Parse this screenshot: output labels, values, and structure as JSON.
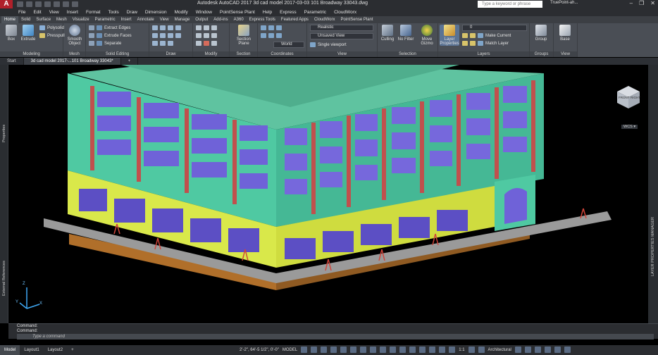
{
  "titlebar": {
    "app_logo": "A",
    "title": "Autodesk AutoCAD 2017   3d cad model 2017-03-03 101 Broadway 33043.dwg",
    "search_placeholder": "Type a keyword or phrase",
    "user": "TruePoint-ah...",
    "minimize": "–",
    "restore": "❐",
    "close": "✕"
  },
  "menubar": {
    "items": [
      "File",
      "Edit",
      "View",
      "Insert",
      "Format",
      "Tools",
      "Draw",
      "Dimension",
      "Modify",
      "Window",
      "PointSense Plant",
      "Help",
      "Express",
      "Parametric",
      "CloudWorx"
    ]
  },
  "ribbon_tabs": {
    "items": [
      "Home",
      "Solid",
      "Surface",
      "Mesh",
      "Visualize",
      "Parametric",
      "Insert",
      "Annotate",
      "View",
      "Manage",
      "Output",
      "Add-ins",
      "A360",
      "Express Tools",
      "Featured Apps",
      "CloudWorx",
      "PointSense Plant"
    ],
    "active": "Home"
  },
  "ribbon": {
    "modeling": {
      "label": "Modeling",
      "box": "Box",
      "extrude": "Extrude",
      "polysolid": "Polysolid",
      "presspull": "Presspull"
    },
    "mesh": {
      "label": "Mesh",
      "smooth_object": "Smooth Object"
    },
    "solid_editing": {
      "label": "Solid Editing",
      "extract_edges": "Extract Edges",
      "extrude_faces": "Extrude Faces",
      "separate": "Separate"
    },
    "draw": {
      "label": "Draw"
    },
    "modify": {
      "label": "Modify"
    },
    "section": {
      "label": "Section",
      "section_plane": "Section Plane"
    },
    "coordinates": {
      "label": "Coordinates",
      "world": "World"
    },
    "view": {
      "label": "View",
      "visual_style": "Realistic",
      "saved_view": "Unsaved View",
      "viewport": "Single viewport"
    },
    "selection": {
      "label": "Selection",
      "culling": "Culling",
      "no_filter": "No Filter",
      "move_gizmo": "Move Gizmo"
    },
    "layers": {
      "label": "Layers",
      "layer_properties": "Layer Properties",
      "current_layer": "0",
      "make_current": "Make Current",
      "match_layer": "Match Layer"
    },
    "groups": {
      "label": "Groups",
      "group": "Group"
    },
    "view2": {
      "label": "View",
      "base": "Base"
    }
  },
  "doc_tabs": {
    "items": [
      "Start",
      "3d cad model 2017-...101 Broadway 33043*"
    ],
    "active": 1,
    "add": "+"
  },
  "viewport": {
    "controls": "",
    "viewcube_top": "FRONT",
    "viewcube_right": "RIGHT",
    "wcs": "WCS ▾",
    "ucs_x": "X",
    "ucs_y": "Y",
    "ucs_z": "Z"
  },
  "palettes": {
    "properties": "Properties",
    "external_references": "External References",
    "layer_properties_manager": "LAYER PROPERTIES MANAGER"
  },
  "command": {
    "history": [
      "Command:",
      "Command:"
    ],
    "placeholder": "Type a command"
  },
  "status": {
    "layout_tabs": [
      "Model",
      "Layout1",
      "Layout2"
    ],
    "active_layout": "Model",
    "add": "+",
    "coordinates": "2'-2\", 64'-5 1/2\", 0'-0\"",
    "model": "MODEL",
    "scale": "1:1",
    "units": "Architectural"
  },
  "colors": {
    "facade_green": "#4fc9a2",
    "storefront_yellow": "#d9e84a",
    "column_red": "#c0504d",
    "window_blue": "#6f62d8",
    "sidewalk_gray": "#9a9a9a",
    "foundation_brown": "#b06f2a",
    "ui_dark": "#2b2d31"
  }
}
